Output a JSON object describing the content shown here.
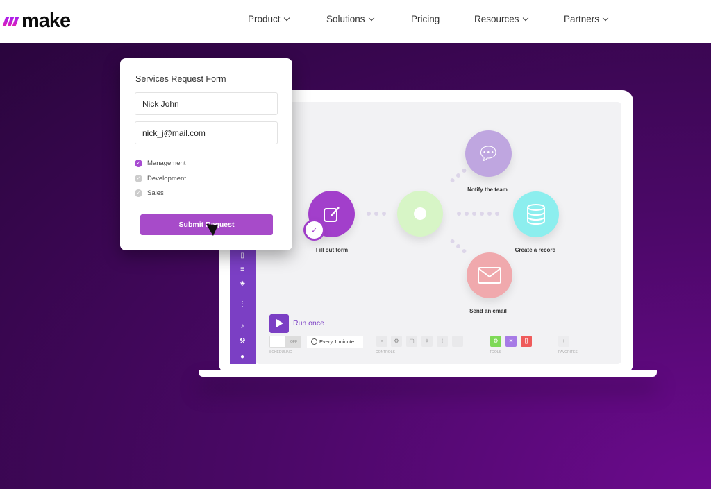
{
  "nav": {
    "brand": "make",
    "items": [
      {
        "label": "Product",
        "dropdown": true
      },
      {
        "label": "Solutions",
        "dropdown": true
      },
      {
        "label": "Pricing",
        "dropdown": false
      },
      {
        "label": "Resources",
        "dropdown": true
      },
      {
        "label": "Partners",
        "dropdown": true
      }
    ]
  },
  "form": {
    "title": "Services Request Form",
    "name_value": "Nick John",
    "email_value": "nick_j@mail.com",
    "options": [
      {
        "label": "Management",
        "checked": true
      },
      {
        "label": "Development",
        "checked": false
      },
      {
        "label": "Sales",
        "checked": false
      }
    ],
    "submit_label": "Submit Request"
  },
  "scenario": {
    "nodes": {
      "trigger": "Fill out form",
      "notify": "Notify the team",
      "record": "Create a record",
      "email": "Send an email"
    },
    "colors": {
      "trigger": "#a23fcb",
      "router": "#d7f5c6",
      "notify": "#bfa6e0",
      "record": "#8ceeee",
      "email": "#f0a9ad"
    }
  },
  "toolbar": {
    "run_label": "Run once",
    "toggle_label": "OFF",
    "schedule": "Every 1 minute.",
    "scheduling_label": "SCHEDULING",
    "controls_label": "CONTROLS",
    "tools_label": "TOOLS",
    "favorites_label": "FAVORITES",
    "favorites_add": "+"
  }
}
